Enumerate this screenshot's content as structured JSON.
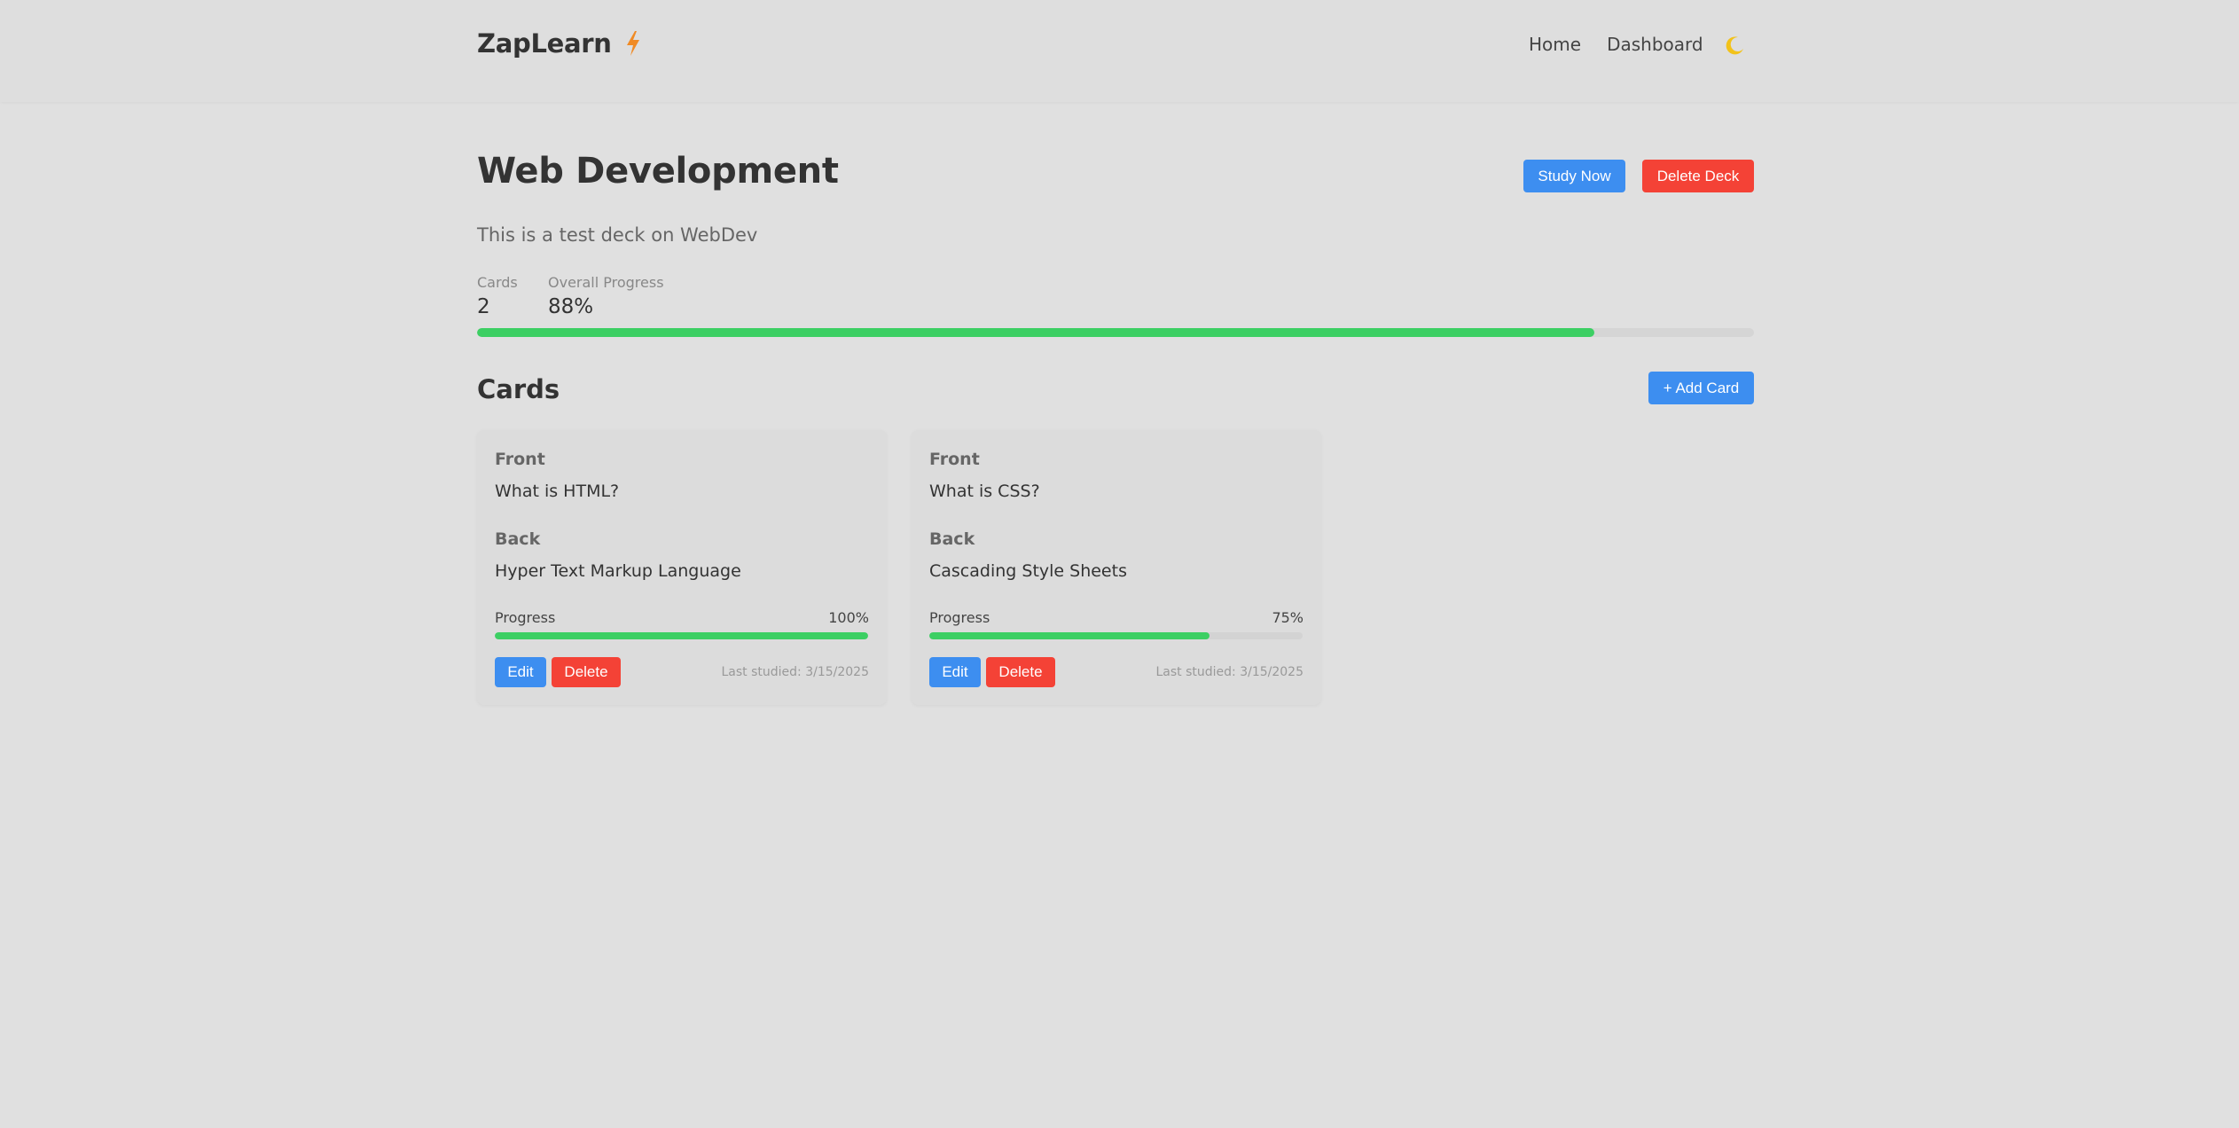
{
  "header": {
    "logo": "ZapLearn",
    "nav": [
      "Home",
      "Dashboard"
    ],
    "icons": {
      "logo": "lightning-bolt-icon",
      "theme": "moon-icon"
    }
  },
  "deck": {
    "title": "Web Development",
    "description": "This is a test deck on WebDev",
    "study_button": "Study Now",
    "delete_button": "Delete Deck",
    "stats": {
      "cards_label": "Cards",
      "cards_value": "2",
      "progress_label": "Overall Progress",
      "progress_value": "88%",
      "progress_fraction": 0.875
    }
  },
  "cards_section": {
    "title": "Cards",
    "add_button": "+ Add Card"
  },
  "cards": [
    {
      "front_label": "Front",
      "front": "What is HTML?",
      "back_label": "Back",
      "back": "Hyper Text Markup Language",
      "progress_label": "Progress",
      "progress_text": "100%",
      "progress_fraction": 1.0,
      "edit": "Edit",
      "delete": "Delete",
      "last_studied": "Last studied: 3/15/2025"
    },
    {
      "front_label": "Front",
      "front": "What is CSS?",
      "back_label": "Back",
      "back": "Cascading Style Sheets",
      "progress_label": "Progress",
      "progress_text": "75%",
      "progress_fraction": 0.75,
      "edit": "Edit",
      "delete": "Delete",
      "last_studied": "Last studied: 3/15/2025"
    }
  ],
  "colors": {
    "accent_blue": "#3d8ef0",
    "danger_red": "#f44236",
    "progress_green": "#3ccf63",
    "bolt_orange": "#f08a24",
    "moon_yellow": "#f2c21a"
  }
}
